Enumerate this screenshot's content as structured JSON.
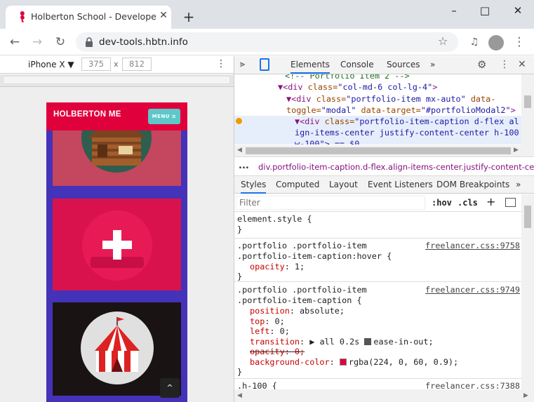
{
  "browser": {
    "tab_title": "Holberton School - Developer to",
    "url": "dev-tools.hbtn.info",
    "new_tab_symbol": "+",
    "close_symbol": "✕"
  },
  "device_toolbar": {
    "device": "iPhone X ▼",
    "width": "375",
    "height": "812",
    "times": "x"
  },
  "phone": {
    "brand": "HOLBERTON ME",
    "menu_label": "MENU ≡",
    "scroll_top": "^"
  },
  "devtools": {
    "tabs": [
      "Elements",
      "Console",
      "Sources",
      "»"
    ],
    "tree": {
      "line0": "<!-- Portfolio Item 2 -->",
      "line1_tag": "▼<div ",
      "line1_attr": "class=",
      "line1_val": "\"col-md-6 col-lg-4\"",
      "line1_end": ">",
      "line2_tag": "▼<div ",
      "line2_attr": "class=",
      "line2_val": "\"portfolio-item mx-auto\"",
      "line2_attr2": " data-",
      "line3_attr": "toggle=",
      "line3_val": "\"modal\"",
      "line3_attr2": " data-target=",
      "line3_val2": "\"#portfolioModal2\"",
      "line3_end": ">",
      "line4_tag": "▼<div ",
      "line4_attr": "class=",
      "line4_val": "\"portfolio-item-caption d-flex al",
      "line5_val": "ign-items-center justify-content-center h-100",
      "line6_val": "w-100\"> == $0"
    },
    "breadcrumb_dots": "...",
    "breadcrumb": "div.portfolio-item-caption.d-flex.align-items-center.justify-content-ce",
    "sub_tabs": [
      "Styles",
      "Computed",
      "Layout",
      "Event Listeners",
      "DOM Breakpoints",
      "»"
    ],
    "filter_placeholder": "Filter",
    "hov": ":hov",
    "cls": ".cls",
    "plus": "+",
    "rules": {
      "r0_sel": "element.style {",
      "r0_close": "}",
      "r1_sel1": ".portfolio .portfolio-item",
      "r1_sel2": ".portfolio-item-caption:hover {",
      "r1_src": "freelancer.css:9758",
      "r1_p1": "opacity",
      "r1_v1": ": 1;",
      "r1_close": "}",
      "r2_sel1": ".portfolio .portfolio-item",
      "r2_sel2": ".portfolio-item-caption {",
      "r2_src": "freelancer.css:9749",
      "r2_p1": "position",
      "r2_v1": ": absolute;",
      "r2_p2": "top",
      "r2_v2": ": 0;",
      "r2_p3": "left",
      "r2_v3": ": 0;",
      "r2_p4": "transition",
      "r2_v4": ": ▶ all 0.2s ",
      "r2_v4b": "ease-in-out;",
      "r2_p5": "opacity: 0;",
      "r2_p6": "background-color",
      "r2_v6": ": ",
      "r2_v6b": "rgba(224, 0, 60, 0.9);",
      "r2_close": "}",
      "r3_sel": ".h-100 {",
      "r3_src": "freelancer.css:7388"
    }
  },
  "colors": {
    "accent_red": "#e0003c",
    "phone_bg": "#4432b8",
    "menu_teal": "#5ec7c9",
    "devtools_blue": "#1a73e8",
    "swatch": "#e0003c"
  }
}
